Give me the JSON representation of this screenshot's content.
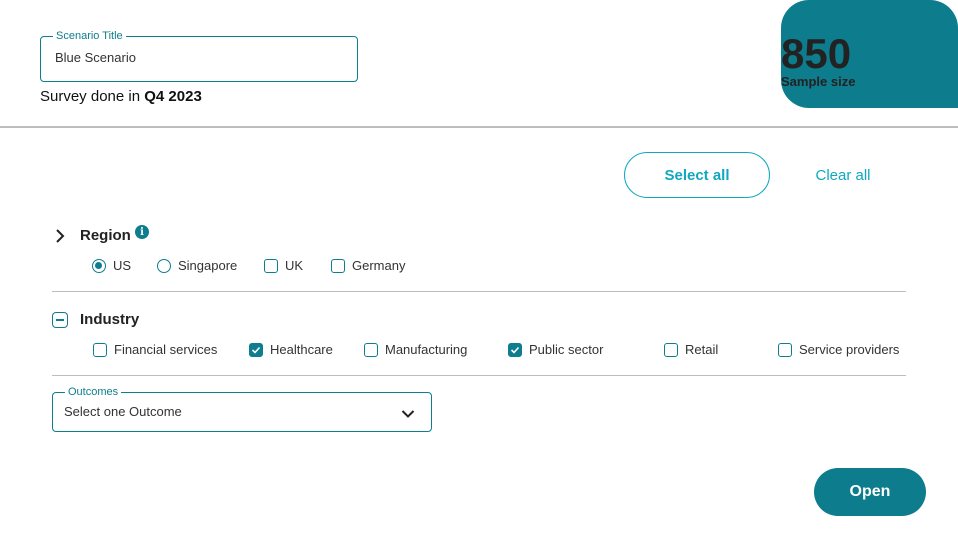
{
  "scenario": {
    "legend": "Scenario Title",
    "value": "Blue Scenario",
    "survey_prefix": "Survey done in",
    "survey_period": "Q4 2023"
  },
  "sample": {
    "count": "850",
    "label": "Sample size"
  },
  "actions": {
    "select_all": "Select all",
    "clear_all": "Clear all",
    "open": "Open"
  },
  "region": {
    "title": "Region",
    "info": "i",
    "options": [
      {
        "label": "US",
        "type": "radio",
        "checked": true
      },
      {
        "label": "Singapore",
        "type": "radio",
        "checked": false
      },
      {
        "label": "UK",
        "type": "checkbox",
        "checked": false
      },
      {
        "label": "Germany",
        "type": "checkbox",
        "checked": false
      }
    ]
  },
  "industry": {
    "title": "Industry",
    "options": [
      {
        "label": "Financial services",
        "checked": false
      },
      {
        "label": "Healthcare",
        "checked": true
      },
      {
        "label": "Manufacturing",
        "checked": false
      },
      {
        "label": "Public sector",
        "checked": true
      },
      {
        "label": "Retail",
        "checked": false
      },
      {
        "label": "Service providers",
        "checked": false
      }
    ]
  },
  "outcomes": {
    "legend": "Outcomes",
    "selected": "Select one Outcome"
  },
  "colors": {
    "accent": "#0d7c8c",
    "link": "#0fa8bf"
  }
}
